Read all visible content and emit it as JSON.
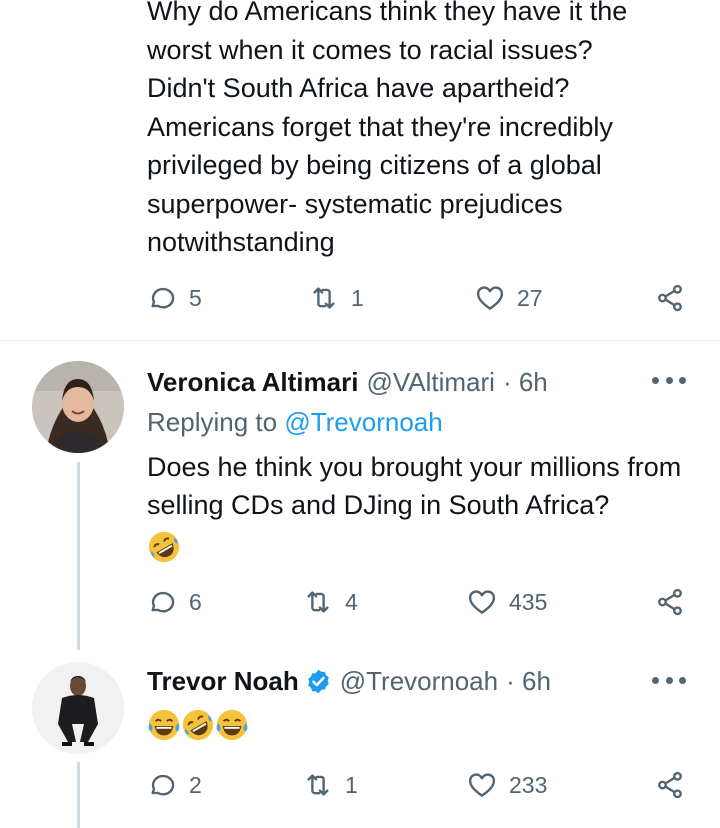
{
  "top_tweet": {
    "text": "Why do Americans think they have it the\nworst when it comes to racial issues?\nDidn't South Africa have apartheid?\nAmericans forget that they're incredibly\nprivileged by being citizens of a global\nsuperpower- systematic prejudices\nnotwithstanding",
    "actions": {
      "replies": "5",
      "retweets": "1",
      "likes": "27"
    }
  },
  "reply1": {
    "name": "Veronica Altimari",
    "handle": "@VAltimari",
    "time": "· 6h",
    "replying_prefix": "Replying to",
    "replying_to": "@Trevornoah",
    "text": "Does he think you brought your millions from selling CDs and DJing in South Africa?",
    "emoji": [
      "rolling-on-floor-laughing"
    ],
    "actions": {
      "replies": "6",
      "retweets": "4",
      "likes": "435"
    }
  },
  "reply2": {
    "name": "Trevor Noah",
    "verified": true,
    "handle": "@Trevornoah",
    "time": "· 6h",
    "emoji": [
      "face-with-tears-of-joy",
      "rolling-on-floor-laughing",
      "face-with-tears-of-joy"
    ],
    "actions": {
      "replies": "2",
      "retweets": "1",
      "likes": "233"
    }
  },
  "colors": {
    "text": "#0f1419",
    "muted": "#536471",
    "link": "#1d9bf0",
    "verified": "#1d9bf0",
    "emoji": "#f5c33b"
  }
}
